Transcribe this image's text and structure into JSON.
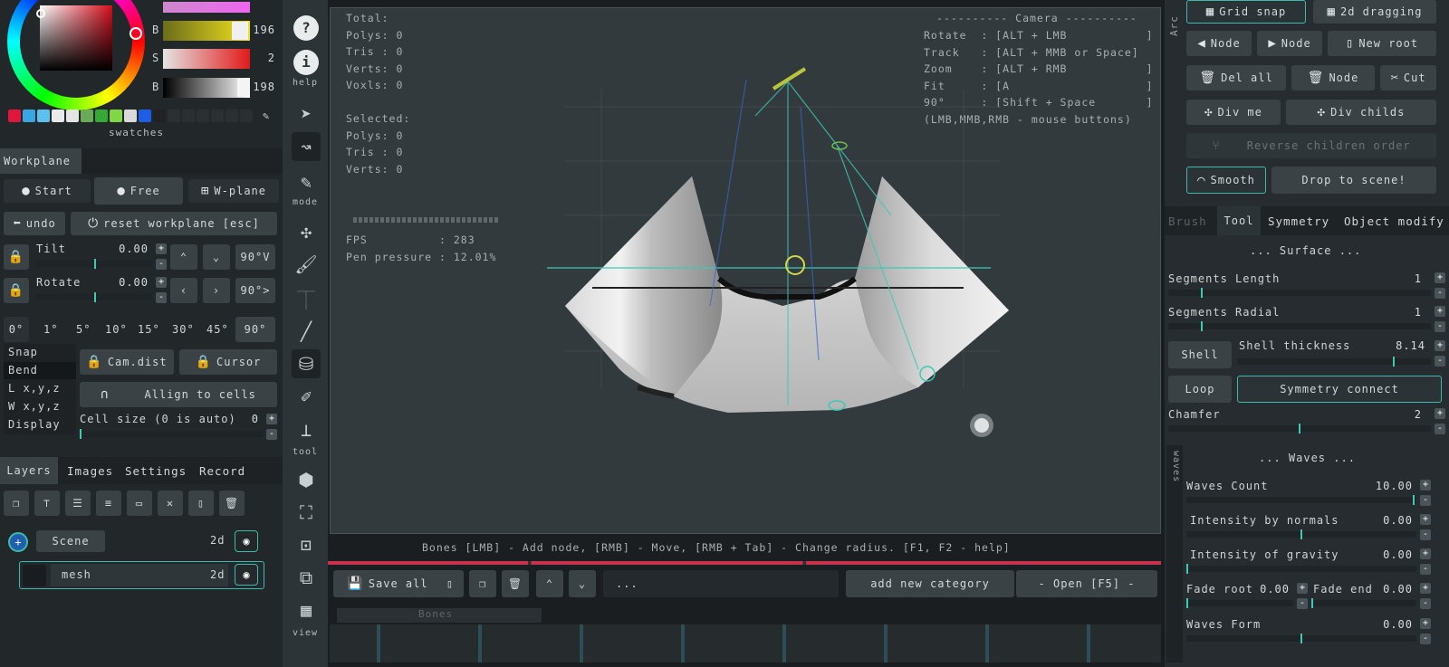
{
  "color_picker": {
    "hue_color": "#d40e1c",
    "channels": [
      {
        "label": "B",
        "value": "196",
        "gradient": "linear-gradient(90deg,#6b6d1a,#f2e31d)"
      },
      {
        "label": "S",
        "value": "2",
        "gradient": "linear-gradient(90deg,#e4e4e4,#e11a1a)"
      },
      {
        "label": "B",
        "value": "198",
        "gradient": "linear-gradient(90deg,#000,#fff)"
      }
    ],
    "swatches_label": "swatches",
    "swatch_colors": [
      "#e0163e",
      "#3aa5e3",
      "#5cc0ec",
      "#e9e9e9",
      "#e4e4e4",
      "#6bab57",
      "#36a836",
      "#7dd842",
      "#d9d9d9",
      "#1e5ee6",
      "#222",
      "#2a2f32",
      "#2a2f32",
      "#2a2f32",
      "#2a2f32",
      "#2a2f32",
      "#2a2f32"
    ]
  },
  "workplane": {
    "tab": "Workplane",
    "start": "Start",
    "free": "Free",
    "wplane": "W-plane",
    "undo": "undo",
    "reset": "reset workplane [esc]",
    "tilt_label": "Tilt",
    "tilt_value": "0.00",
    "rotate_label": "Rotate",
    "rotate_value": "0.00",
    "btn_90v": "90°V",
    "btn_90h": "90°>",
    "angles": [
      "0°",
      "1°",
      "5°",
      "10°",
      "15°",
      "30°",
      "45°",
      "90°"
    ],
    "snap_items": [
      "Snap",
      "Bend",
      "L x,y,z",
      "W x,y,z",
      "Display"
    ],
    "cam_dist": "Cam.dist",
    "cursor": "Cursor",
    "align": "Allign to cells",
    "cell_size": "Cell size (0 is auto)",
    "cell_value": "0"
  },
  "layers": {
    "tabs": [
      "Layers",
      "Images",
      "Settings",
      "Record"
    ],
    "scene": "Scene",
    "scene_badge": "2d",
    "mesh": "mesh",
    "mesh_badge": "2d"
  },
  "toolbar": {
    "help_label": "help",
    "mode_label": "mode",
    "tool_label": "tool",
    "view_label": "view"
  },
  "viewport": {
    "stats_left": "Total:\nPolys: 0\nTris : 0\nVerts: 0\nVoxls: 0\n\nSelected:\nPolys: 0\nTris : 0\nVerts: 0",
    "fps": "FPS          : 283\nPen pressure : 12.01%",
    "camera_title": "---------- Camera ----------",
    "camera_help": "Rotate  : [ALT + LMB           ]\nTrack   : [ALT + MMB or Space]\nZoom    : [ALT + RMB           ]\nFit     : [A                   ]\n90°     : [Shift + Space       ]\n(LMB,MMB,RMB - mouse buttons)",
    "status": "Bones [LMB] - Add node, [RMB] - Move, [RMB + Tab] - Change radius. [F1, F2 - help]"
  },
  "bottom_bar": {
    "save_all": "Save all",
    "search": "...",
    "add_category": "add new category",
    "open": "- Open [F5] -",
    "shelf_tab": "Bones"
  },
  "right": {
    "arc_label": "Arc",
    "grid_snap": "Grid snap",
    "drag_2d": "2d dragging",
    "node_prev": "Node",
    "node_next": "Node",
    "new_root": "New root",
    "del_all": "Del all",
    "del_node": "Node",
    "cut": "Cut",
    "div_me": "Div me",
    "div_childs": "Div childs",
    "reverse": "Reverse children order",
    "smooth": "Smooth",
    "drop": "Drop to scene!",
    "tabs": [
      "Brush",
      "Tool",
      "Symmetry",
      "Object modify"
    ],
    "surface_title": "... Surface ...",
    "seg_length": "Segments Length",
    "seg_length_val": "1",
    "seg_radial": "Segments Radial",
    "seg_radial_val": "1",
    "shell": "Shell",
    "shell_thickness": "Shell thickness",
    "shell_thickness_val": "8.14",
    "loop": "Loop",
    "sym_connect": "Symmetry connect",
    "chamfer": "Chamfer",
    "chamfer_val": "2",
    "waves_side": "waves",
    "waves_title": "... Waves ...",
    "waves_count": "Waves Count",
    "waves_count_val": "10.00",
    "int_normals": "Intensity by normals",
    "int_normals_val": "0.00",
    "int_gravity": "Intensity of gravity",
    "int_gravity_val": "0.00",
    "fade_root": "Fade root",
    "fade_root_val": "0.00",
    "fade_end": "Fade end",
    "fade_end_val": "0.00",
    "waves_form": "Waves Form",
    "waves_form_val": "0.00"
  }
}
